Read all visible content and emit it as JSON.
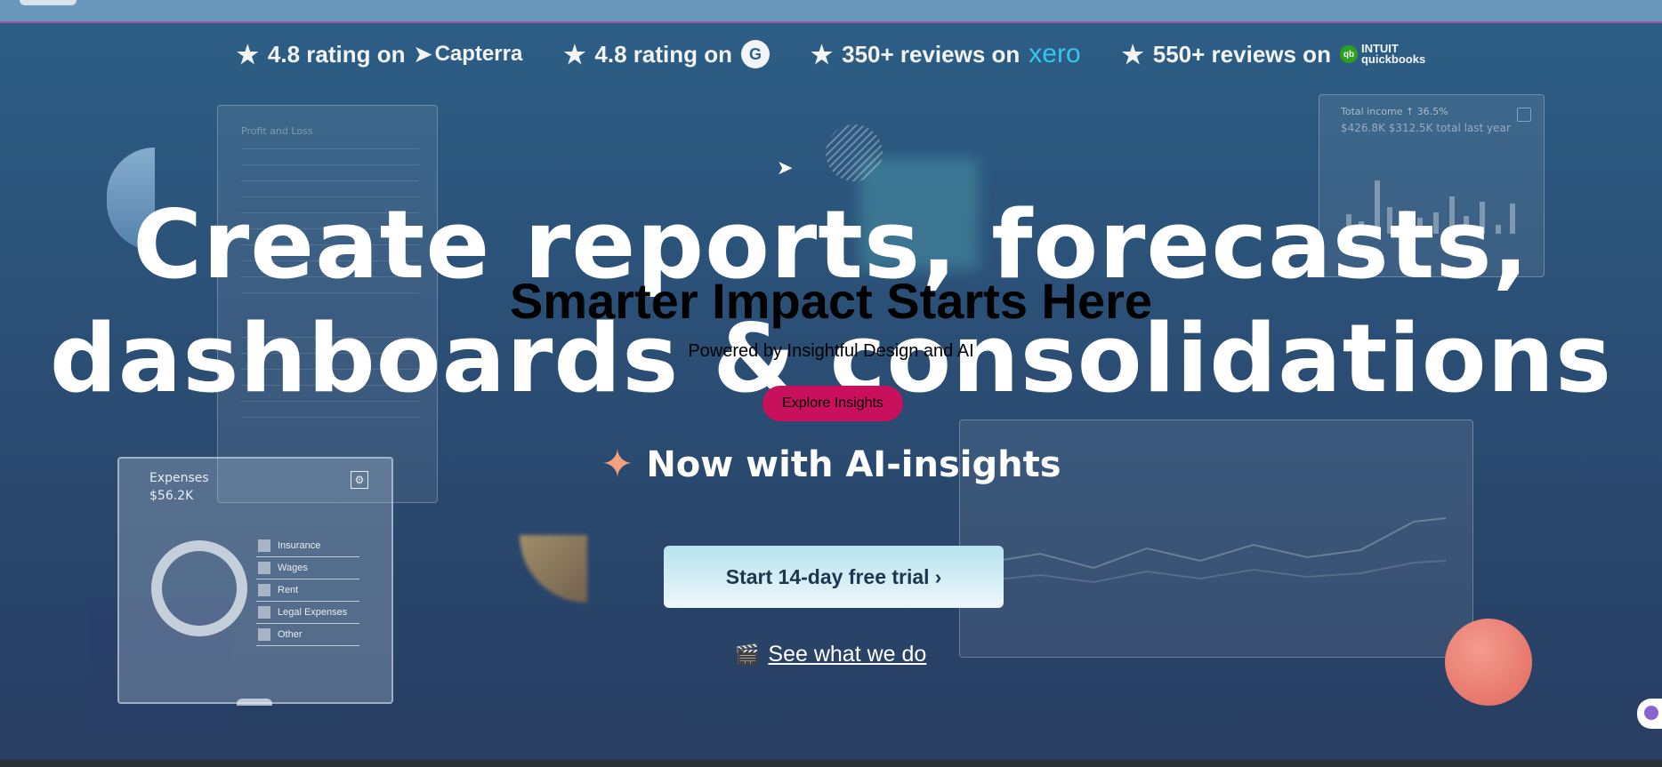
{
  "ratings": [
    {
      "text": "4.8 rating on",
      "logo": "Capterra"
    },
    {
      "text": "4.8 rating on",
      "logo": "G"
    },
    {
      "text": "350+ reviews on",
      "logo": "xero"
    },
    {
      "text": "550+ reviews on",
      "logo_top": "INTUIT",
      "logo_bottom": "quickbooks",
      "logo_badge": "qb"
    }
  ],
  "bg_cards": {
    "pl_title": "Profit and Loss",
    "income_title": "Total income ↑ 36.5%",
    "income_value": "$426.8K $312.5K total last year"
  },
  "expenses": {
    "title": "Expenses",
    "value": "$56.2K",
    "legend": [
      "Insurance",
      "Wages",
      "Rent",
      "Legal Expenses",
      "Other"
    ]
  },
  "headline": {
    "line1": "Create reports, forecasts,",
    "line2": "dashboards & consolidations"
  },
  "overlay": {
    "title": "Smarter Impact Starts Here",
    "subtitle": "Powered by Insightful Design and AI",
    "button": "Explore Insights"
  },
  "ai_line": "Now with AI-insights",
  "cta": {
    "trial_label": "Start 14-day free trial",
    "trial_chevron": "›",
    "see_label": "See what we do"
  },
  "icons": {
    "star": "star-icon",
    "sparkle": "sparkle-icon",
    "clapper": "clapperboard-icon",
    "gear": "gear-icon"
  },
  "colors": {
    "accent_pink": "#c8105c",
    "xero_blue": "#35c5ee",
    "coral": "#e0685e"
  }
}
